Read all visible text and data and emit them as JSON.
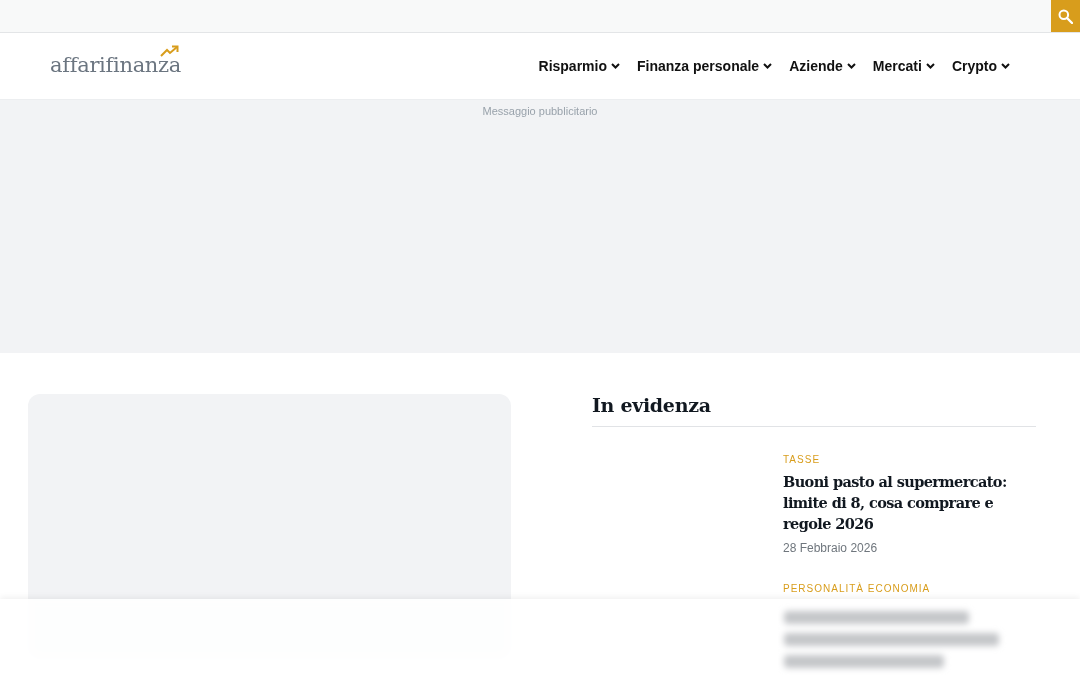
{
  "logo": {
    "text": "affarifinanza"
  },
  "nav": [
    {
      "label": "Risparmio"
    },
    {
      "label": "Finanza personale"
    },
    {
      "label": "Aziende"
    },
    {
      "label": "Mercati"
    },
    {
      "label": "Crypto"
    }
  ],
  "ad": {
    "label": "Messaggio pubblicitario"
  },
  "featured": {
    "title": "In evidenza",
    "articles": [
      {
        "category": "TASSE",
        "title": "Buoni pasto al supermercato: limite di 8, cosa comprare e regole 2026",
        "date": "28 Febbraio 2026"
      },
      {
        "category": "PERSONALITÀ ECONOMIA"
      }
    ]
  }
}
